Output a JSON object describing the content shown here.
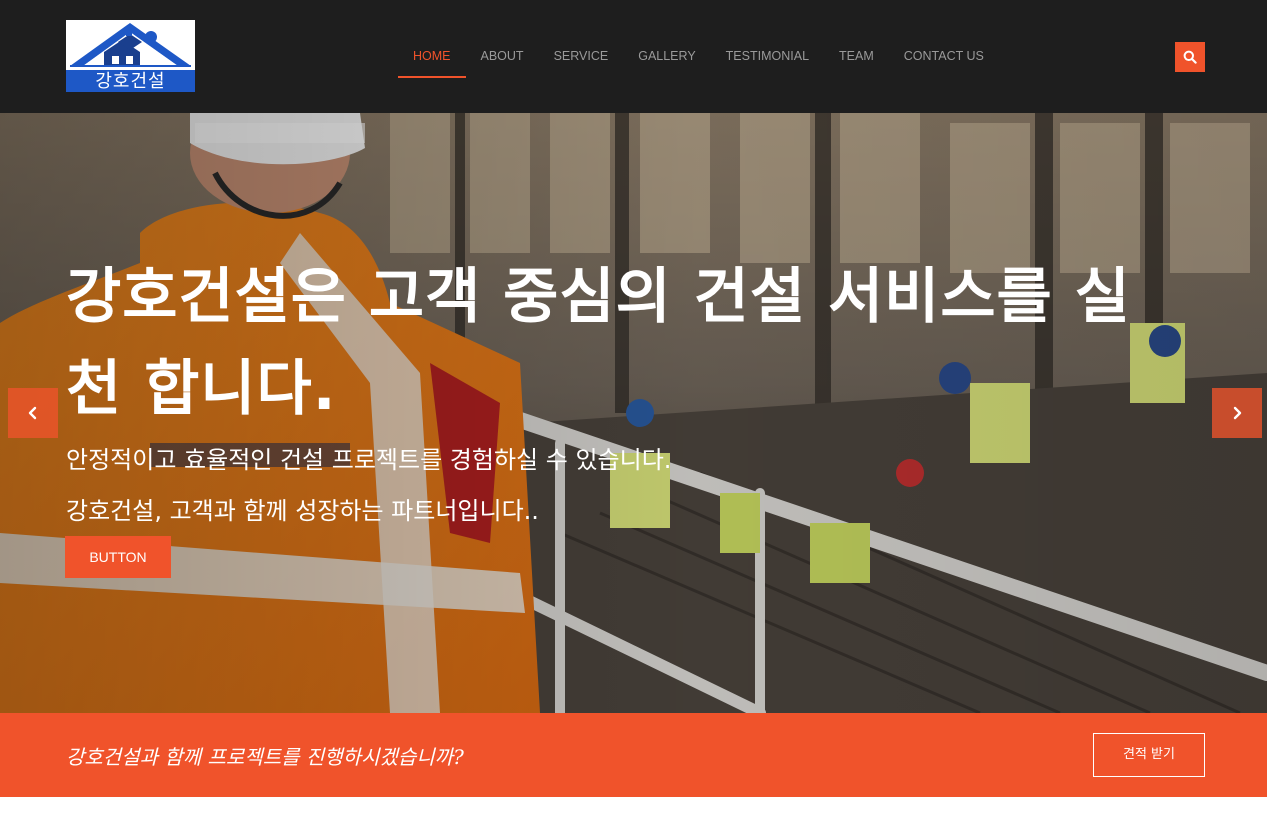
{
  "header": {
    "logo_text": "강호건설",
    "nav": [
      {
        "label": "HOME",
        "active": true
      },
      {
        "label": "ABOUT",
        "active": false
      },
      {
        "label": "SERVICE",
        "active": false
      },
      {
        "label": "GALLERY",
        "active": false
      },
      {
        "label": "TESTIMONIAL",
        "active": false
      },
      {
        "label": "TEAM",
        "active": false
      },
      {
        "label": "CONTACT US",
        "active": false
      }
    ],
    "search_icon": "search-icon"
  },
  "hero": {
    "title": "강호건설은 고객 중심의 건설 서비스를 실천 합니다.",
    "subtitle_1": "안정적이고 효율적인 건설 프로젝트를 경험하실 수 있습니다.",
    "subtitle_2": "강호건설, 고객과 함께 성장하는 파트너입니다..",
    "button_label": "BUTTON",
    "prev_icon": "chevron-left-icon",
    "next_icon": "chevron-right-icon"
  },
  "cta": {
    "text": "강호건설과 함께 프로젝트를 진행하시겠습니까?",
    "button_label": "견적 받기"
  },
  "colors": {
    "accent": "#f0532b",
    "header_bg": "#1e1e1e",
    "logo_blue": "#1e58c6"
  }
}
